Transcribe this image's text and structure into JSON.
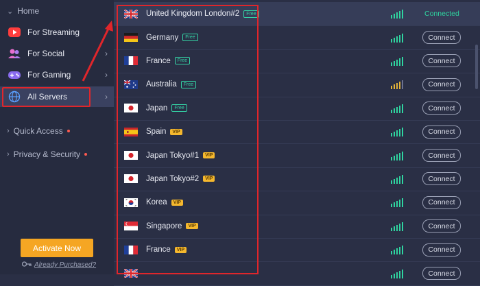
{
  "sidebar": {
    "home_label": "Home",
    "items": [
      {
        "label": "For Streaming",
        "icon": "youtube-icon",
        "has_arrow": false
      },
      {
        "label": "For Social",
        "icon": "people-icon",
        "has_arrow": true
      },
      {
        "label": "For Gaming",
        "icon": "gamepad-icon",
        "has_arrow": true
      },
      {
        "label": "All Servers",
        "icon": "globe-icon",
        "has_arrow": true,
        "active": true
      }
    ],
    "sub": [
      {
        "label": "Quick Access",
        "dot": true
      },
      {
        "label": "Privacy & Security",
        "dot": true
      }
    ],
    "activate_label": "Activate Now",
    "purchased_label": "Already Purchased?"
  },
  "servers": [
    {
      "name": "United Kingdom London#2",
      "tag": "Free",
      "signal": "strong",
      "status": "Connected",
      "flag": "uk"
    },
    {
      "name": "Germany",
      "tag": "Free",
      "signal": "strong",
      "status": "Connect",
      "flag": "de"
    },
    {
      "name": "France",
      "tag": "Free",
      "signal": "strong",
      "status": "Connect",
      "flag": "fr"
    },
    {
      "name": "Australia",
      "tag": "Free",
      "signal": "medium",
      "status": "Connect",
      "flag": "au"
    },
    {
      "name": "Japan",
      "tag": "Free",
      "signal": "strong",
      "status": "Connect",
      "flag": "jp"
    },
    {
      "name": "Spain",
      "tag": "VIP",
      "signal": "strong",
      "status": "Connect",
      "flag": "es"
    },
    {
      "name": "Japan Tokyo#1",
      "tag": "VIP",
      "signal": "strong",
      "status": "Connect",
      "flag": "jp"
    },
    {
      "name": "Japan Tokyo#2",
      "tag": "VIP",
      "signal": "strong",
      "status": "Connect",
      "flag": "jp"
    },
    {
      "name": "Korea",
      "tag": "VIP",
      "signal": "strong",
      "status": "Connect",
      "flag": "kr"
    },
    {
      "name": "Singapore",
      "tag": "VIP",
      "signal": "strong",
      "status": "Connect",
      "flag": "sg"
    },
    {
      "name": "France",
      "tag": "VIP",
      "signal": "strong",
      "status": "Connect",
      "flag": "fr"
    },
    {
      "name": "",
      "tag": "",
      "signal": "strong",
      "status": "Connect",
      "flag": "uk"
    }
  ],
  "colors": {
    "accent_green": "#2fd5a0",
    "vip_gold": "#f5b82e",
    "activate_orange": "#f5a623",
    "highlight_red": "#e0262b"
  }
}
